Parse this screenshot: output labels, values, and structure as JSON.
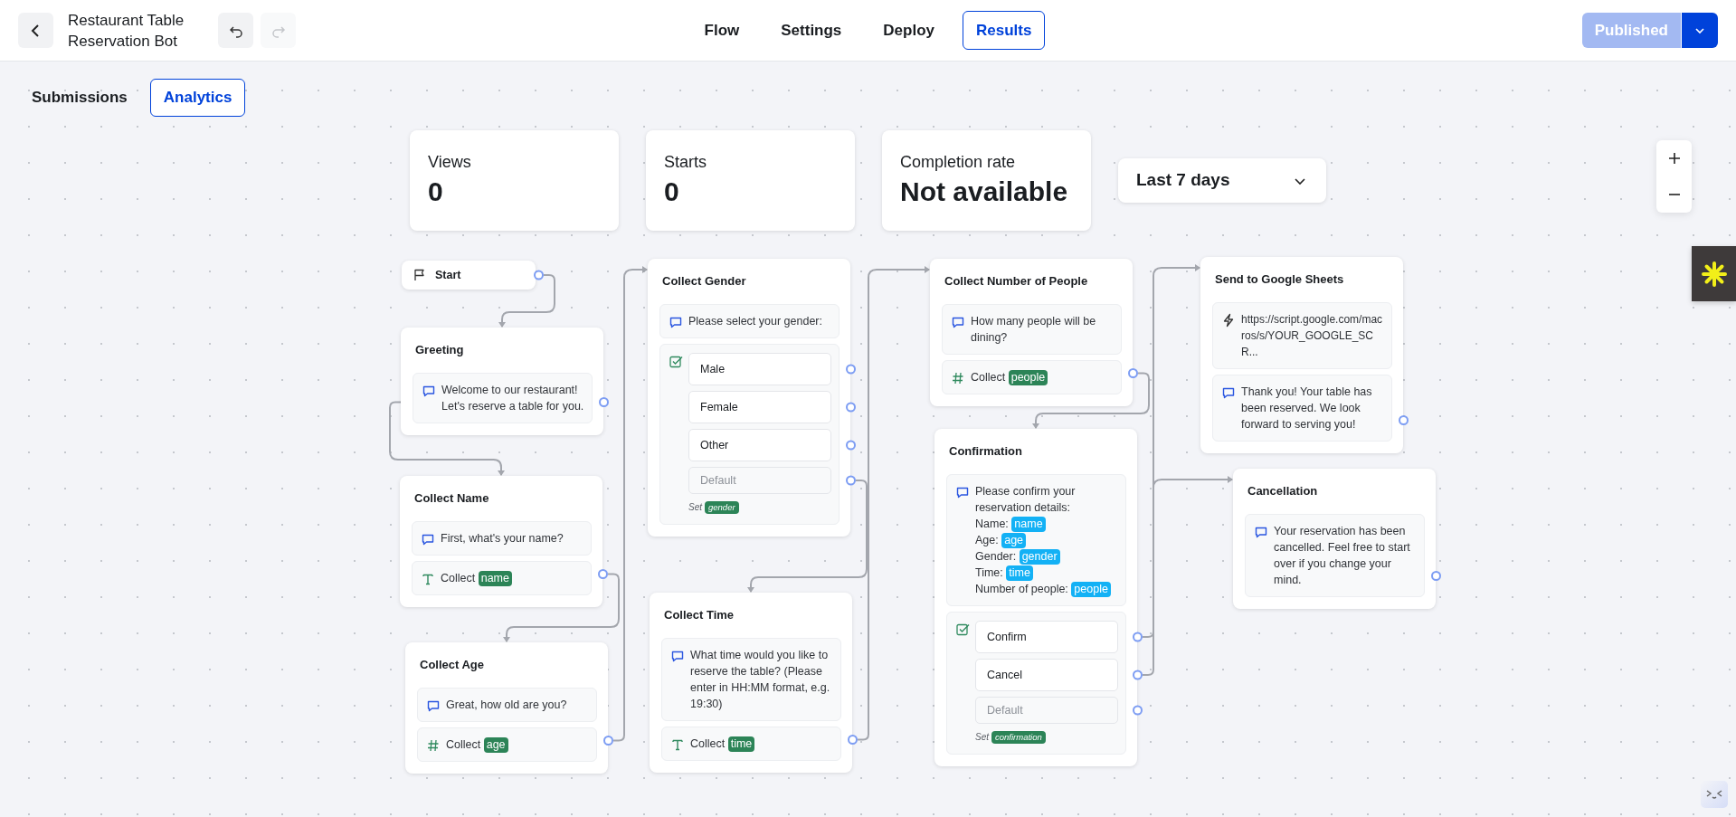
{
  "header": {
    "title": "Restaurant Table Reservation Bot",
    "undo": {
      "disabled": false
    },
    "redo": {
      "disabled": true
    },
    "tabs": [
      {
        "label": "Flow",
        "selected": false
      },
      {
        "label": "Settings",
        "selected": false
      },
      {
        "label": "Deploy",
        "selected": false
      },
      {
        "label": "Results",
        "selected": true
      }
    ],
    "publish": {
      "label": "Published",
      "disabled": true
    }
  },
  "view_tabs": [
    {
      "label": "Submissions",
      "selected": false
    },
    {
      "label": "Analytics",
      "selected": true
    }
  ],
  "stats": [
    {
      "label": "Views",
      "value": "0"
    },
    {
      "label": "Starts",
      "value": "0"
    },
    {
      "label": "Completion rate",
      "value": "Not available"
    }
  ],
  "date_range": {
    "value": "Last 7 days"
  },
  "nodes": [
    {
      "kind": "start",
      "title": "Start"
    },
    {
      "kind": "group",
      "title": "Greeting",
      "blocks": [
        {
          "kind": "text",
          "text": "Welcome to our restaurant! Let's reserve a table for you."
        }
      ]
    },
    {
      "kind": "group",
      "title": "Collect Name",
      "blocks": [
        {
          "kind": "text",
          "text": "First, what's your name?"
        },
        {
          "kind": "text_input",
          "label": "Collect",
          "variable": "name"
        }
      ]
    },
    {
      "kind": "group",
      "title": "Collect Age",
      "blocks": [
        {
          "kind": "text",
          "text": "Great, how old are you?"
        },
        {
          "kind": "number_input",
          "label": "Collect",
          "variable": "age"
        }
      ]
    },
    {
      "kind": "group",
      "title": "Collect Gender",
      "blocks": [
        {
          "kind": "text",
          "text": "Please select your gender:"
        },
        {
          "kind": "choice",
          "items": [
            "Male",
            "Female",
            "Other"
          ],
          "default_placeholder": "Default",
          "set_label": "Set",
          "variable": "gender"
        }
      ]
    },
    {
      "kind": "group",
      "title": "Collect Time",
      "blocks": [
        {
          "kind": "text",
          "text": "What time would you like to reserve the table? (Please enter in HH:MM format, e.g. 19:30)"
        },
        {
          "kind": "text_input",
          "label": "Collect",
          "variable": "time"
        }
      ]
    },
    {
      "kind": "group",
      "title": "Collect Number of People",
      "blocks": [
        {
          "kind": "text",
          "text": "How many people will be dining?"
        },
        {
          "kind": "number_input",
          "label": "Collect",
          "variable": "people"
        }
      ]
    },
    {
      "kind": "group",
      "title": "Confirmation",
      "blocks": [
        {
          "kind": "template",
          "lines": [
            {
              "text": "Please confirm your reservation details:"
            },
            {
              "text": "Name:",
              "variable": "name"
            },
            {
              "text": "Age:",
              "variable": "age"
            },
            {
              "text": "Gender:",
              "variable": "gender"
            },
            {
              "text": "Time:",
              "variable": "time"
            },
            {
              "text": "Number of people:",
              "variable": "people"
            }
          ]
        },
        {
          "kind": "choice",
          "items": [
            "Confirm",
            "Cancel"
          ],
          "default_placeholder": "Default",
          "set_label": "Set",
          "variable": "confirmation"
        }
      ]
    },
    {
      "kind": "group",
      "title": "Send to Google Sheets",
      "blocks": [
        {
          "kind": "webhook",
          "text": "https://script.google.com/macros/s/YOUR_GOOGLE_SCR..."
        },
        {
          "kind": "text",
          "text": "Thank you! Your table has been reserved. We look forward to serving you!"
        }
      ]
    },
    {
      "kind": "group",
      "title": "Cancellation",
      "blocks": [
        {
          "kind": "text",
          "text": "Your reservation has been cancelled. Feel free to start over if you change your mind."
        }
      ]
    }
  ]
}
